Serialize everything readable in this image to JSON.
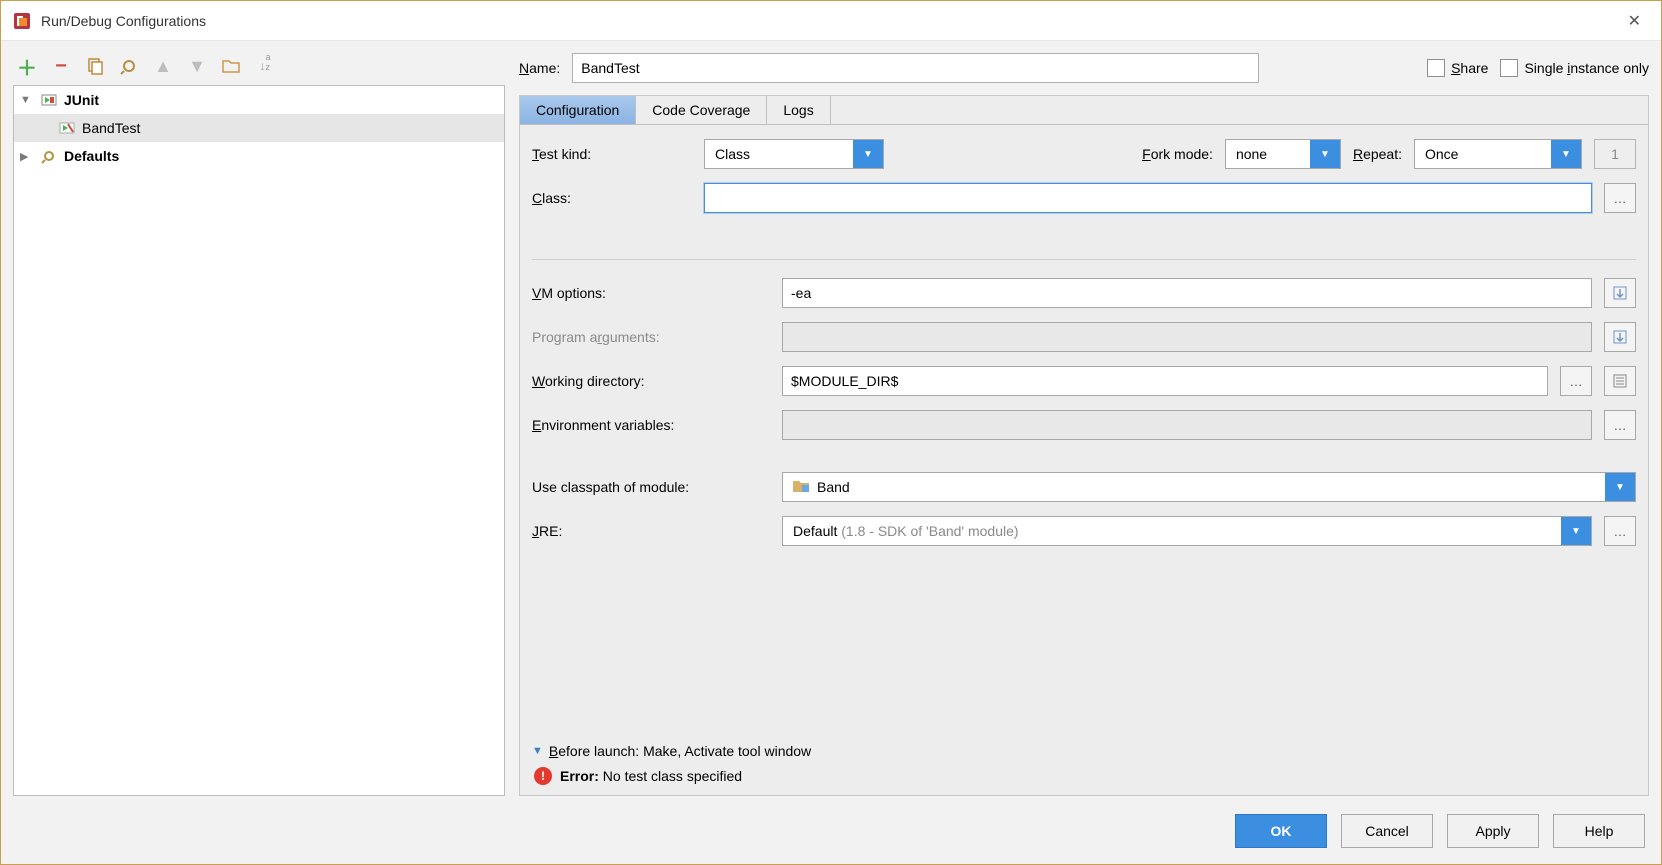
{
  "window": {
    "title": "Run/Debug Configurations"
  },
  "tree": {
    "junit_label": "JUnit",
    "bandtest_label": "BandTest",
    "defaults_label": "Defaults"
  },
  "nameRow": {
    "label": "Name:",
    "value": "BandTest",
    "share": "Share",
    "single": "Single instance only"
  },
  "tabs": {
    "t0": "Configuration",
    "t1": "Code Coverage",
    "t2": "Logs"
  },
  "form": {
    "testkind_label": "Test kind:",
    "testkind_value": "Class",
    "forkmode_label": "Fork mode:",
    "forkmode_value": "none",
    "repeat_label": "Repeat:",
    "repeat_value": "Once",
    "repeat_count": "1",
    "class_label": "Class:",
    "class_value": "",
    "vm_label": "VM options:",
    "vm_value": "-ea",
    "progargs_label": "Program arguments:",
    "progargs_value": "",
    "workdir_label": "Working directory:",
    "workdir_value": "$MODULE_DIR$",
    "envvars_label": "Environment variables:",
    "envvars_value": "",
    "classpath_label": "Use classpath of module:",
    "classpath_value": "Band",
    "jre_label": "JRE:",
    "jre_value_main": "Default ",
    "jre_value_hint": "(1.8 - SDK of 'Band' module)"
  },
  "beforeLaunch": {
    "label_prefix": "Before launch: ",
    "label_rest": "Make, Activate tool window"
  },
  "error": {
    "label": "Error:",
    "msg": " No test class specified"
  },
  "buttons": {
    "ok": "OK",
    "cancel": "Cancel",
    "apply": "Apply",
    "help": "Help"
  }
}
